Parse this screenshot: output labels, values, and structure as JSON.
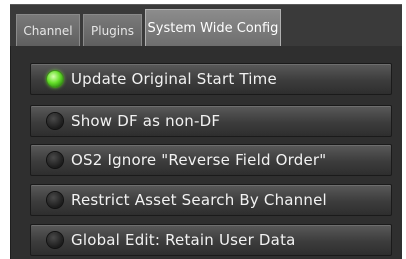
{
  "tabs": [
    {
      "label": "Channel",
      "active": false
    },
    {
      "label": "Plugins",
      "active": false
    },
    {
      "label": "System Wide Config",
      "active": true
    }
  ],
  "options": [
    {
      "label": "Update Original Start Time",
      "enabled": true
    },
    {
      "label": "Show DF as non-DF",
      "enabled": false
    },
    {
      "label": "OS2 Ignore \"Reverse Field Order\"",
      "enabled": false
    },
    {
      "label": "Restrict Asset Search By Channel",
      "enabled": false
    },
    {
      "label": "Global Edit: Retain User Data",
      "enabled": false
    }
  ],
  "colors": {
    "led_on": "#66e02a",
    "led_off": "#1c1c1c",
    "panel_bg": "#2f2f2f"
  }
}
